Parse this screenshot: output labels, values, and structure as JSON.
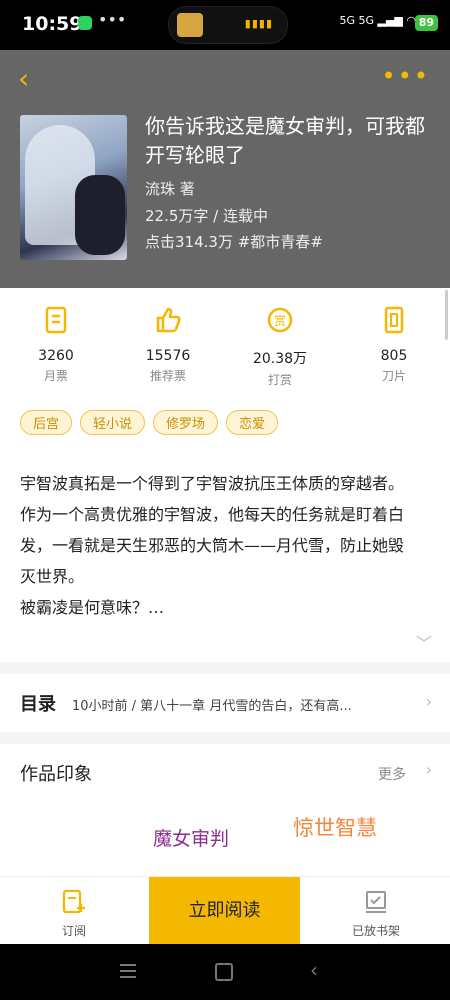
{
  "status_bar": {
    "time": "10:59",
    "signal": "5G 5G",
    "battery": "89"
  },
  "book": {
    "title": "你告诉我这是魔女审判，可我都开写轮眼了",
    "author": "流珠  著",
    "words_status": "22.5万字 / 连载中",
    "clicks_genre": "点击314.3万  #都市青春#"
  },
  "stats": [
    {
      "value": "3260",
      "label": "月票",
      "icon": "ticket-icon"
    },
    {
      "value": "15576",
      "label": "推荐票",
      "icon": "thumbs-up-icon"
    },
    {
      "value": "20.38万",
      "label": "打赏",
      "icon": "reward-coin-icon"
    },
    {
      "value": "805",
      "label": "刀片",
      "icon": "blade-icon"
    }
  ],
  "tags": [
    "后宫",
    "轻小说",
    "修罗场",
    "恋爱"
  ],
  "description": [
    "宇智波真拓是一个得到了宇智波抗压王体质的穿越者。",
    "作为一个高贵优雅的宇智波，他每天的任务就是盯着白",
    "发，一看就是天生邪恶的大筒木——月代雪，防止她毁",
    "灭世界。",
    "被霸凌是何意味？…"
  ],
  "toc": {
    "label": "目录",
    "latest": "10小时前 / 第八十一章  月代雪的告白，还有高..."
  },
  "impression": {
    "title": "作品印象",
    "more": "更多",
    "keywords": [
      "魔女审判",
      "惊世智慧"
    ]
  },
  "bottom_bar": {
    "subscribe": "订阅",
    "read_now": "立即阅读",
    "shelf": "已放书架"
  },
  "colors": {
    "accent": "#f5b800",
    "header_bg": "#666666",
    "keyword1": "#8a2f8e",
    "keyword2": "#f2873b"
  }
}
